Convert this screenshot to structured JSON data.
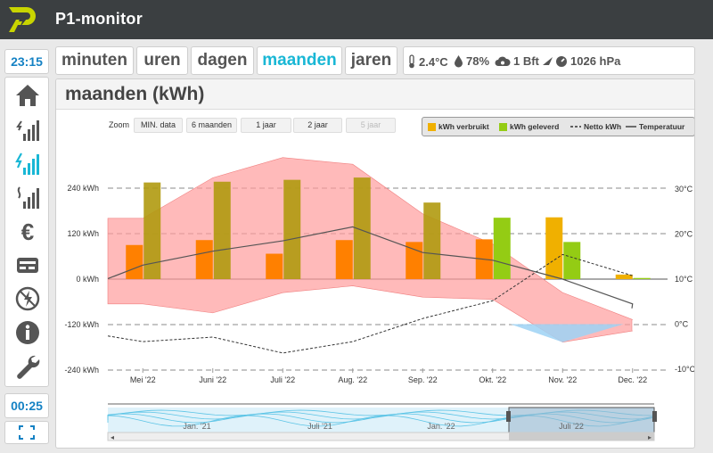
{
  "app": {
    "title": "P1-monitor",
    "clock": "23:15",
    "timer": "00:25"
  },
  "sidebar": {
    "items": [
      {
        "name": "home-icon"
      },
      {
        "name": "usage-bars-icon"
      },
      {
        "name": "power-bars-icon"
      },
      {
        "name": "gas-bars-icon"
      },
      {
        "name": "euro-icon"
      },
      {
        "name": "meter-icon"
      },
      {
        "name": "no-power-icon"
      },
      {
        "name": "info-icon"
      },
      {
        "name": "wrench-icon"
      }
    ],
    "fullscreen_icon": "fullscreen-icon"
  },
  "tabs": [
    {
      "label": "minuten",
      "active": false
    },
    {
      "label": "uren",
      "active": false
    },
    {
      "label": "dagen",
      "active": false
    },
    {
      "label": "maanden",
      "active": true
    },
    {
      "label": "jaren",
      "active": false
    }
  ],
  "weather": {
    "temperature": "2.4°C",
    "humidity": "78%",
    "wind": "1 Bft",
    "pressure": "1026 hPa"
  },
  "panel": {
    "title": "maanden (kWh)"
  },
  "zoom": {
    "label": "Zoom",
    "buttons": [
      {
        "label": "MIN. data",
        "enabled": true
      },
      {
        "label": "6 maanden",
        "enabled": true
      },
      {
        "label": "1 jaar",
        "enabled": true
      },
      {
        "label": "2 jaar",
        "enabled": true
      },
      {
        "label": "5 jaar",
        "enabled": false
      }
    ]
  },
  "legend": [
    {
      "label": "kWh verbruikt",
      "color": "#f0b000",
      "kind": "box"
    },
    {
      "label": "kWh geleverd",
      "color": "#94cc14",
      "kind": "box"
    },
    {
      "label": "Netto kWh",
      "color": "#333333",
      "kind": "dashed"
    },
    {
      "label": "Temperatuur",
      "color": "#444444",
      "kind": "solid"
    }
  ],
  "colors": {
    "accent": "#19b7d5",
    "verbruikt": "#f0b000",
    "geleverd": "#94cc14",
    "dal": "#ff8000",
    "temp_band": "#ff9c9c",
    "cold_band": "#9ed2f5"
  },
  "chart_data": {
    "type": "bar",
    "categories": [
      "Mei '22",
      "Juni '22",
      "Juli '22",
      "Aug. '22",
      "Sep. '22",
      "Okt. '22",
      "Nov. '22",
      "Dec. '22"
    ],
    "series": [
      {
        "name": "kWh verbruikt",
        "values": [
          90,
          103,
          67,
          103,
          98,
          105,
          163,
          12
        ]
      },
      {
        "name": "kWh geleverd",
        "values": [
          255,
          257,
          262,
          268,
          202,
          162,
          98,
          3
        ]
      }
    ],
    "temperature": {
      "name": "Temperatuur",
      "values": [
        13.1,
        16.2,
        18.5,
        21.6,
        15.9,
        14.2,
        10.0,
        4.5
      ],
      "band_high": [
        23.5,
        32.5,
        37.0,
        35.5,
        24.5,
        17.8,
        7.0,
        1.0
      ],
      "band_low": [
        4.5,
        2.5,
        7.0,
        8.5,
        6.0,
        5.5,
        -4.0,
        -1.5
      ]
    },
    "netto": {
      "name": "Netto kWh",
      "values": [
        -165,
        -153,
        -195,
        -165,
        -104,
        -57,
        65,
        9
      ]
    },
    "y_left": {
      "ticks": [
        "240 kWh",
        "120 kWh",
        "0 kWh",
        "-120 kWh",
        "-240 kWh"
      ],
      "values": [
        240,
        120,
        0,
        -120,
        -240
      ],
      "range": [
        -240,
        240
      ]
    },
    "y_right": {
      "ticks": [
        "30°C",
        "20°C",
        "10°C",
        "0°C",
        "-10°C"
      ],
      "values": [
        30,
        20,
        10,
        0,
        -10
      ],
      "range": [
        -10,
        30
      ]
    },
    "navigator": {
      "labels": [
        "Jan. '21",
        "Juli '21",
        "Jan. '22",
        "Juli '22"
      ]
    }
  }
}
